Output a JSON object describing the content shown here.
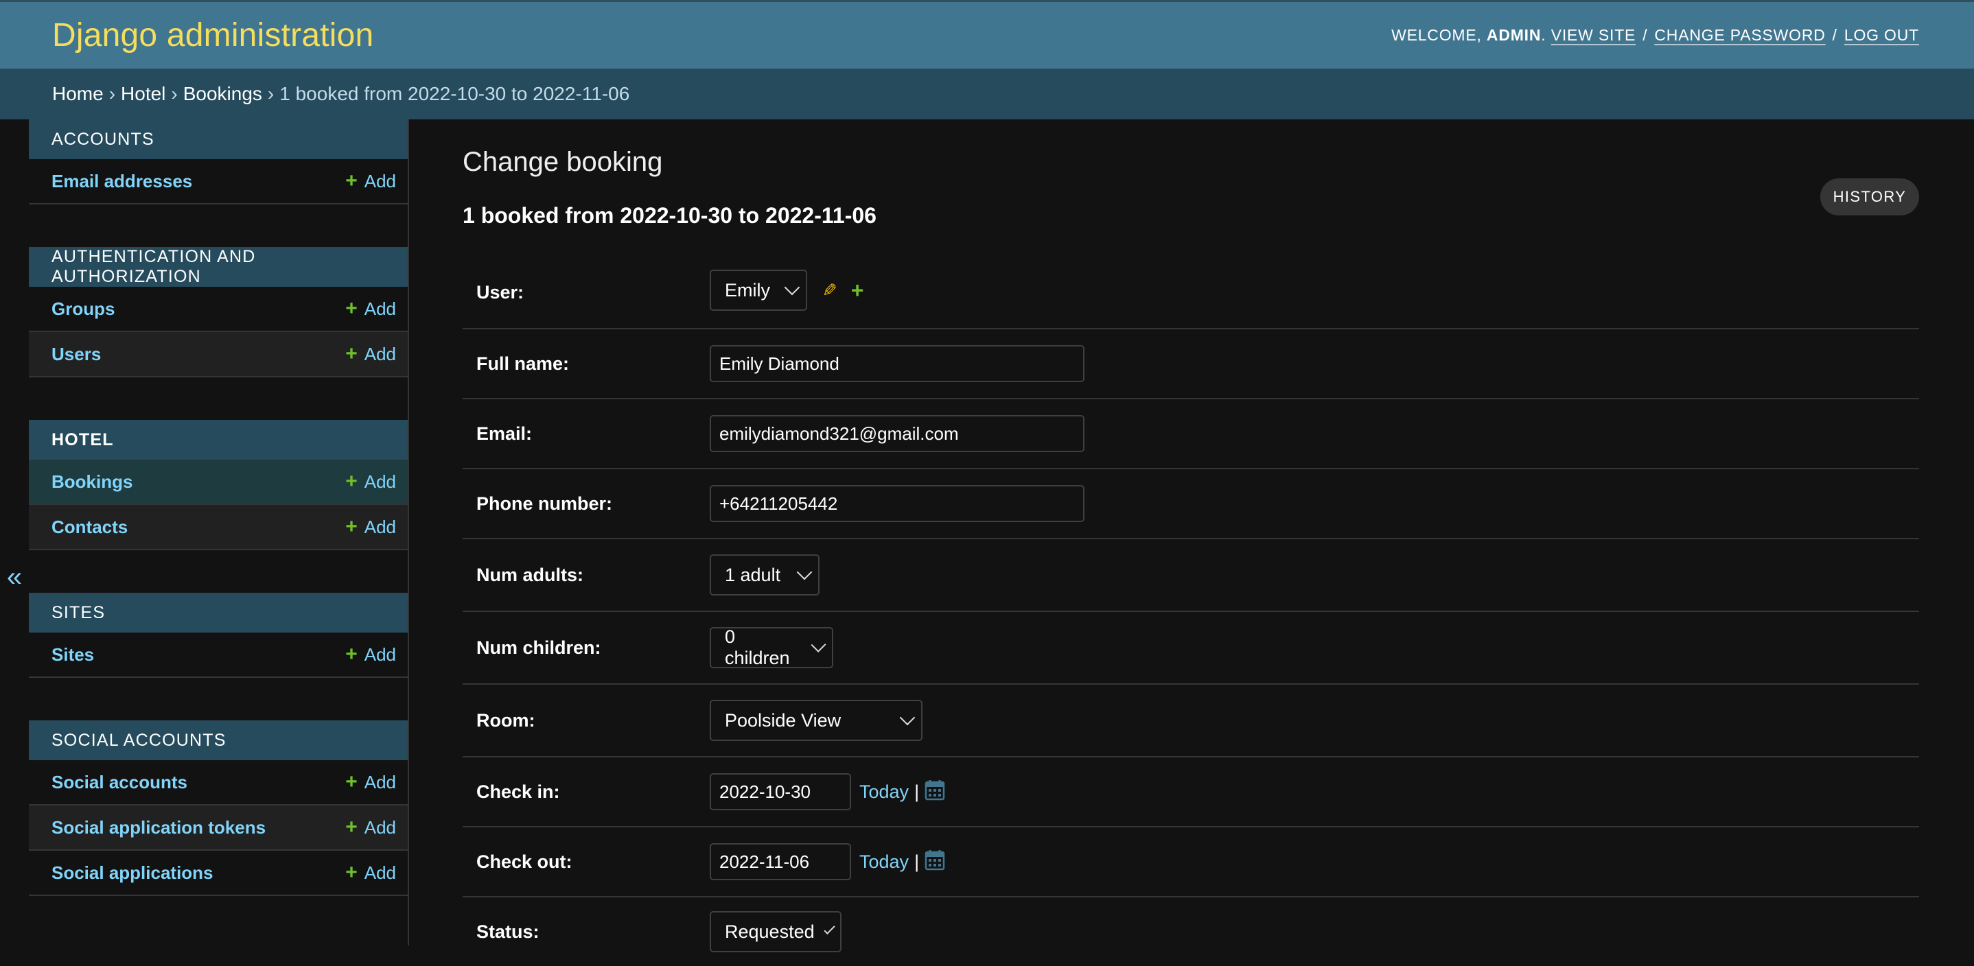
{
  "header": {
    "branding": "Django administration",
    "welcome": "WELCOME,",
    "user": "ADMIN",
    "view_site": "VIEW SITE",
    "change_password": "CHANGE PASSWORD",
    "log_out": "LOG OUT"
  },
  "breadcrumbs": {
    "home": "Home",
    "app": "Hotel",
    "model": "Bookings",
    "current": "1 booked from 2022-10-30 to 2022-11-06",
    "separator": "›"
  },
  "sidebar": {
    "toggle_icon": "«",
    "modules": [
      {
        "caption": "ACCOUNTS",
        "rows": [
          {
            "name": "Email addresses",
            "add": "Add"
          }
        ]
      },
      {
        "caption": "AUTHENTICATION AND AUTHORIZATION",
        "rows": [
          {
            "name": "Groups",
            "add": "Add"
          },
          {
            "name": "Users",
            "add": "Add"
          }
        ]
      },
      {
        "caption": "HOTEL",
        "rows": [
          {
            "name": "Bookings",
            "add": "Add"
          },
          {
            "name": "Contacts",
            "add": "Add"
          }
        ]
      },
      {
        "caption": "SITES",
        "rows": [
          {
            "name": "Sites",
            "add": "Add"
          }
        ]
      },
      {
        "caption": "SOCIAL ACCOUNTS",
        "rows": [
          {
            "name": "Social accounts",
            "add": "Add"
          },
          {
            "name": "Social application tokens",
            "add": "Add"
          },
          {
            "name": "Social applications",
            "add": "Add"
          }
        ]
      }
    ]
  },
  "content": {
    "title": "Change booking",
    "history": "HISTORY",
    "object_title": "1 booked from 2022-10-30 to 2022-11-06",
    "fields": {
      "user": {
        "label": "User:",
        "value": "Emily"
      },
      "full_name": {
        "label": "Full name:",
        "value": "Emily Diamond"
      },
      "email": {
        "label": "Email:",
        "value": "emilydiamond321@gmail.com"
      },
      "phone": {
        "label": "Phone number:",
        "value": "+64211205442"
      },
      "num_adults": {
        "label": "Num adults:",
        "value": "1 adult"
      },
      "num_children": {
        "label": "Num children:",
        "value": "0 children"
      },
      "room": {
        "label": "Room:",
        "value": "Poolside View"
      },
      "check_in": {
        "label": "Check in:",
        "value": "2022-10-30",
        "today": "Today",
        "pipe": "|"
      },
      "check_out": {
        "label": "Check out:",
        "value": "2022-11-06",
        "today": "Today",
        "pipe": "|"
      },
      "status": {
        "label": "Status:",
        "value": "Requested"
      }
    }
  },
  "colors": {
    "header_bg": "#417690",
    "breadcrumb_bg": "#264b5d",
    "branding": "#f5dd5d",
    "link": "#81d4fa",
    "add_plus": "#70bf2b",
    "edit_pencil": "#efb80b",
    "background": "#121212"
  }
}
